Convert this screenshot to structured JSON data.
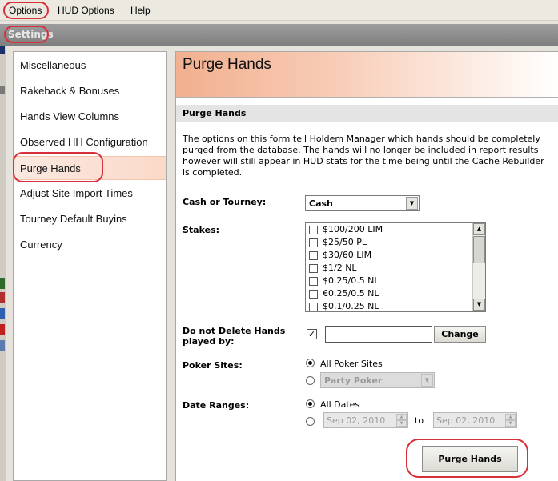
{
  "menu": {
    "items": [
      "Options",
      "HUD Options",
      "Help"
    ]
  },
  "settings_title": "Settings",
  "nav": {
    "items": [
      "Miscellaneous",
      "Rakeback & Bonuses",
      "Hands View Columns",
      "Observed HH Configuration",
      "Purge Hands",
      "Adjust Site Import Times",
      "Tourney Default Buyins",
      "Currency"
    ],
    "active_index": 4
  },
  "content": {
    "title": "Purge Hands",
    "section_title": "Purge Hands",
    "description": "The options on this form tell Holdem Manager which hands should be completely purged from the database.  The hands will no longer be included in report results however will still appear in HUD stats for the time being until the Cache Rebuilder is completed."
  },
  "form": {
    "cash_or_tourney": {
      "label": "Cash or Tourney:",
      "value": "Cash"
    },
    "stakes": {
      "label": "Stakes:",
      "items": [
        {
          "label": "$100/200 LIM",
          "checked": false
        },
        {
          "label": "$25/50 PL",
          "checked": false
        },
        {
          "label": "$30/60 LIM",
          "checked": false
        },
        {
          "label": "$1/2 NL",
          "checked": false
        },
        {
          "label": "$0.25/0.5 NL",
          "checked": false
        },
        {
          "label": "€0.25/0.5 NL",
          "checked": false
        },
        {
          "label": "$0.1/0.25 NL",
          "checked": false
        }
      ]
    },
    "do_not_delete": {
      "label": "Do not Delete Hands played by:",
      "checked": true,
      "value": "",
      "change_label": "Change"
    },
    "poker_sites": {
      "label": "Poker Sites:",
      "all_label": "All Poker Sites",
      "selected": "all",
      "site_value": "Party Poker"
    },
    "date_ranges": {
      "label": "Date Ranges:",
      "all_label": "All Dates",
      "selected": "all",
      "from": "Sep 02, 2010",
      "to_label": "to",
      "to": "Sep 02, 2010"
    },
    "purge_button": "Purge Hands"
  },
  "colors": {
    "highlight_ring": "#d8303a",
    "header_gradient_start": "#f2b08f",
    "active_nav_bg": "#fbd9c9"
  }
}
